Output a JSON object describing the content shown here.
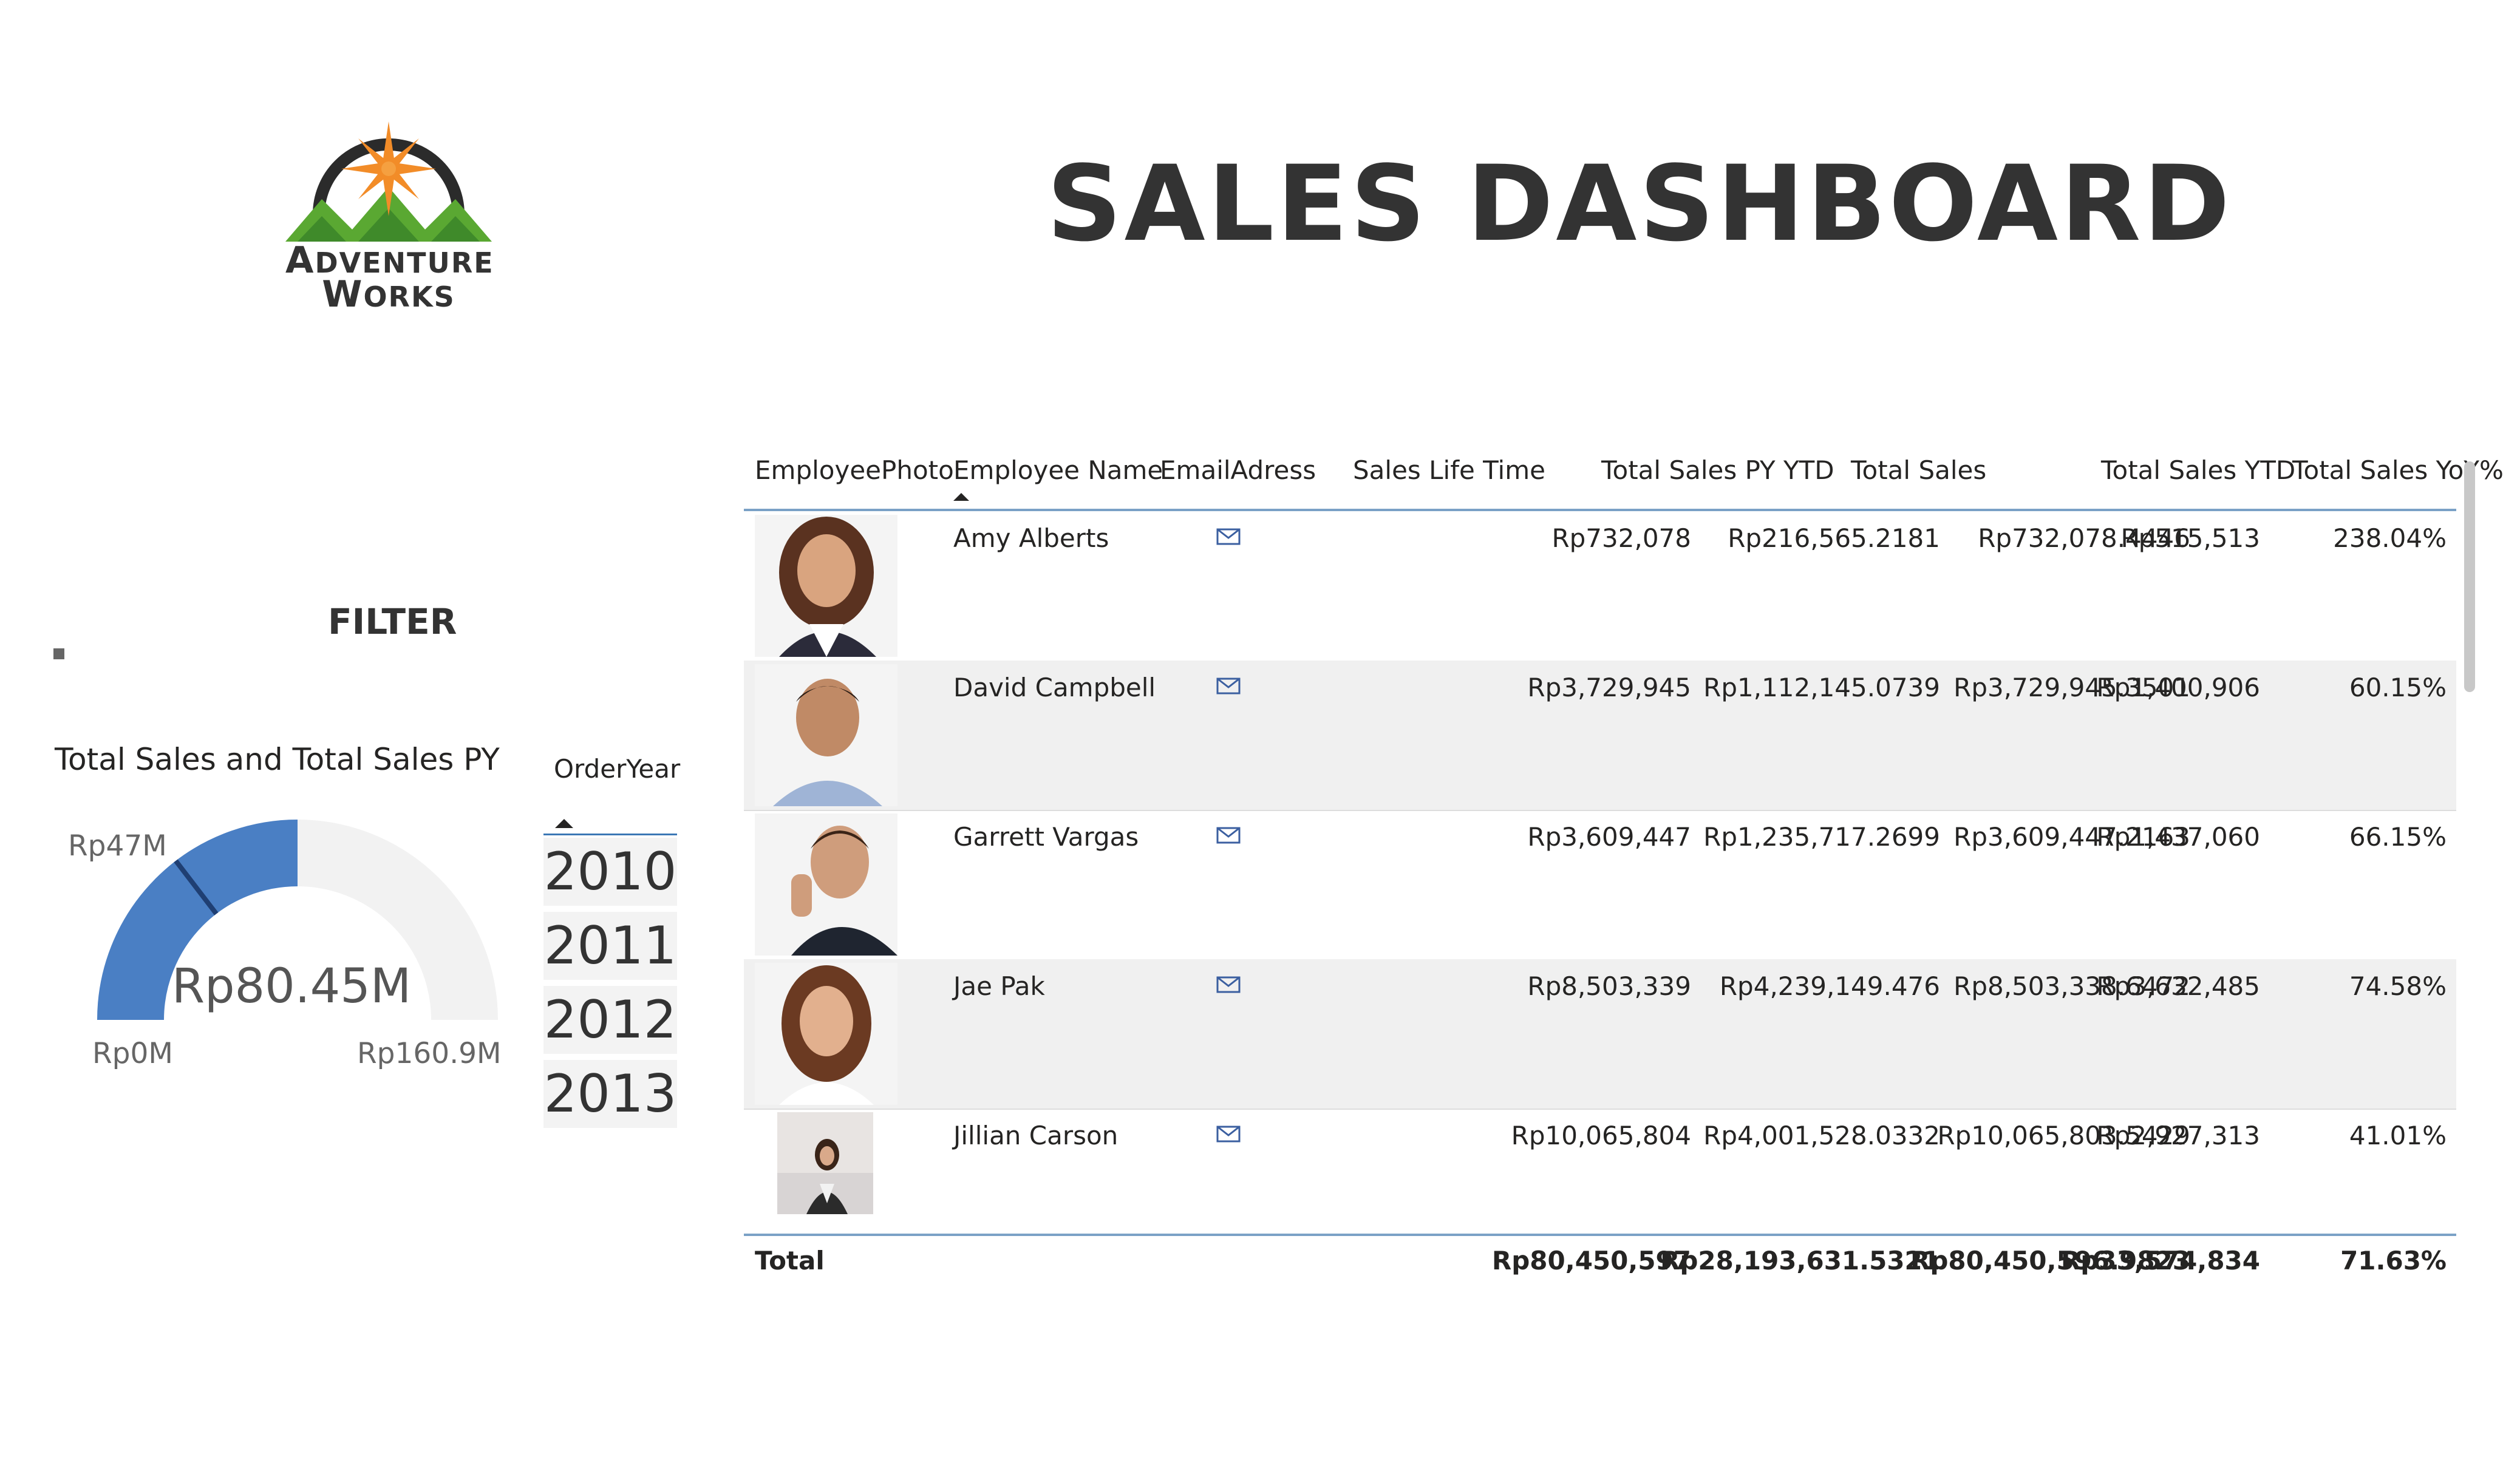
{
  "logo": {
    "line1": "Adventure",
    "line2": "Works"
  },
  "title": "SALES DASHBOARD",
  "filter_label": "FILTER",
  "gauge": {
    "title": "Total Sales and Total Sales PY",
    "value_label": "Rp80.45M",
    "min_label": "Rp0M",
    "max_label": "Rp160.9M",
    "target_label": "Rp47M",
    "value": 80.45,
    "min": 0,
    "max": 160.9,
    "target": 47,
    "fill_color": "#4a7fc4",
    "track_color": "#f2f2f2",
    "target_color": "#1f3f73"
  },
  "slicer": {
    "title": "OrderYear",
    "items": [
      "2010",
      "2011",
      "2012",
      "2013"
    ]
  },
  "table": {
    "headers": [
      "EmployeePhoto",
      "Employee Name",
      "EmailAdress",
      "Sales Life Time",
      "Total Sales PY YTD",
      "Total Sales",
      "Total Sales YTD",
      "Total Sales YoY%"
    ],
    "rows": [
      {
        "name": "Amy Alberts",
        "email_icon": "mail-icon",
        "life": "Rp732,078",
        "pyytd": "Rp216,565.2181",
        "total": "Rp732,078.4446",
        "ytd": "Rp515,513",
        "yoy": "238.04%"
      },
      {
        "name": "David Campbell",
        "email_icon": "mail-icon",
        "life": "Rp3,729,945",
        "pyytd": "Rp1,112,145.0739",
        "total": "Rp3,729,945.3501",
        "ytd": "Rp1,400,906",
        "yoy": "60.15%"
      },
      {
        "name": "Garrett Vargas",
        "email_icon": "mail-icon",
        "life": "Rp3,609,447",
        "pyytd": "Rp1,235,717.2699",
        "total": "Rp3,609,447.2163",
        "ytd": "Rp1,437,060",
        "yoy": "66.15%"
      },
      {
        "name": "Jae Pak",
        "email_icon": "mail-icon",
        "life": "Rp8,503,339",
        "pyytd": "Rp4,239,149.476",
        "total": "Rp8,503,338.6472",
        "ytd": "Rp3,632,485",
        "yoy": "74.58%"
      },
      {
        "name": "Jillian Carson",
        "email_icon": "mail-icon",
        "life": "Rp10,065,804",
        "pyytd": "Rp4,001,528.0332",
        "total": "Rp10,065,803.5429",
        "ytd": "Rp2,927,313",
        "yoy": "41.01%"
      }
    ],
    "total": {
      "label": "Total",
      "life": "Rp80,450,597",
      "pyytd": "Rp28,193,631.5321",
      "total": "Rp80,450,596.9823",
      "ytd": "Rp33,574,834",
      "yoy": "71.63%"
    }
  }
}
